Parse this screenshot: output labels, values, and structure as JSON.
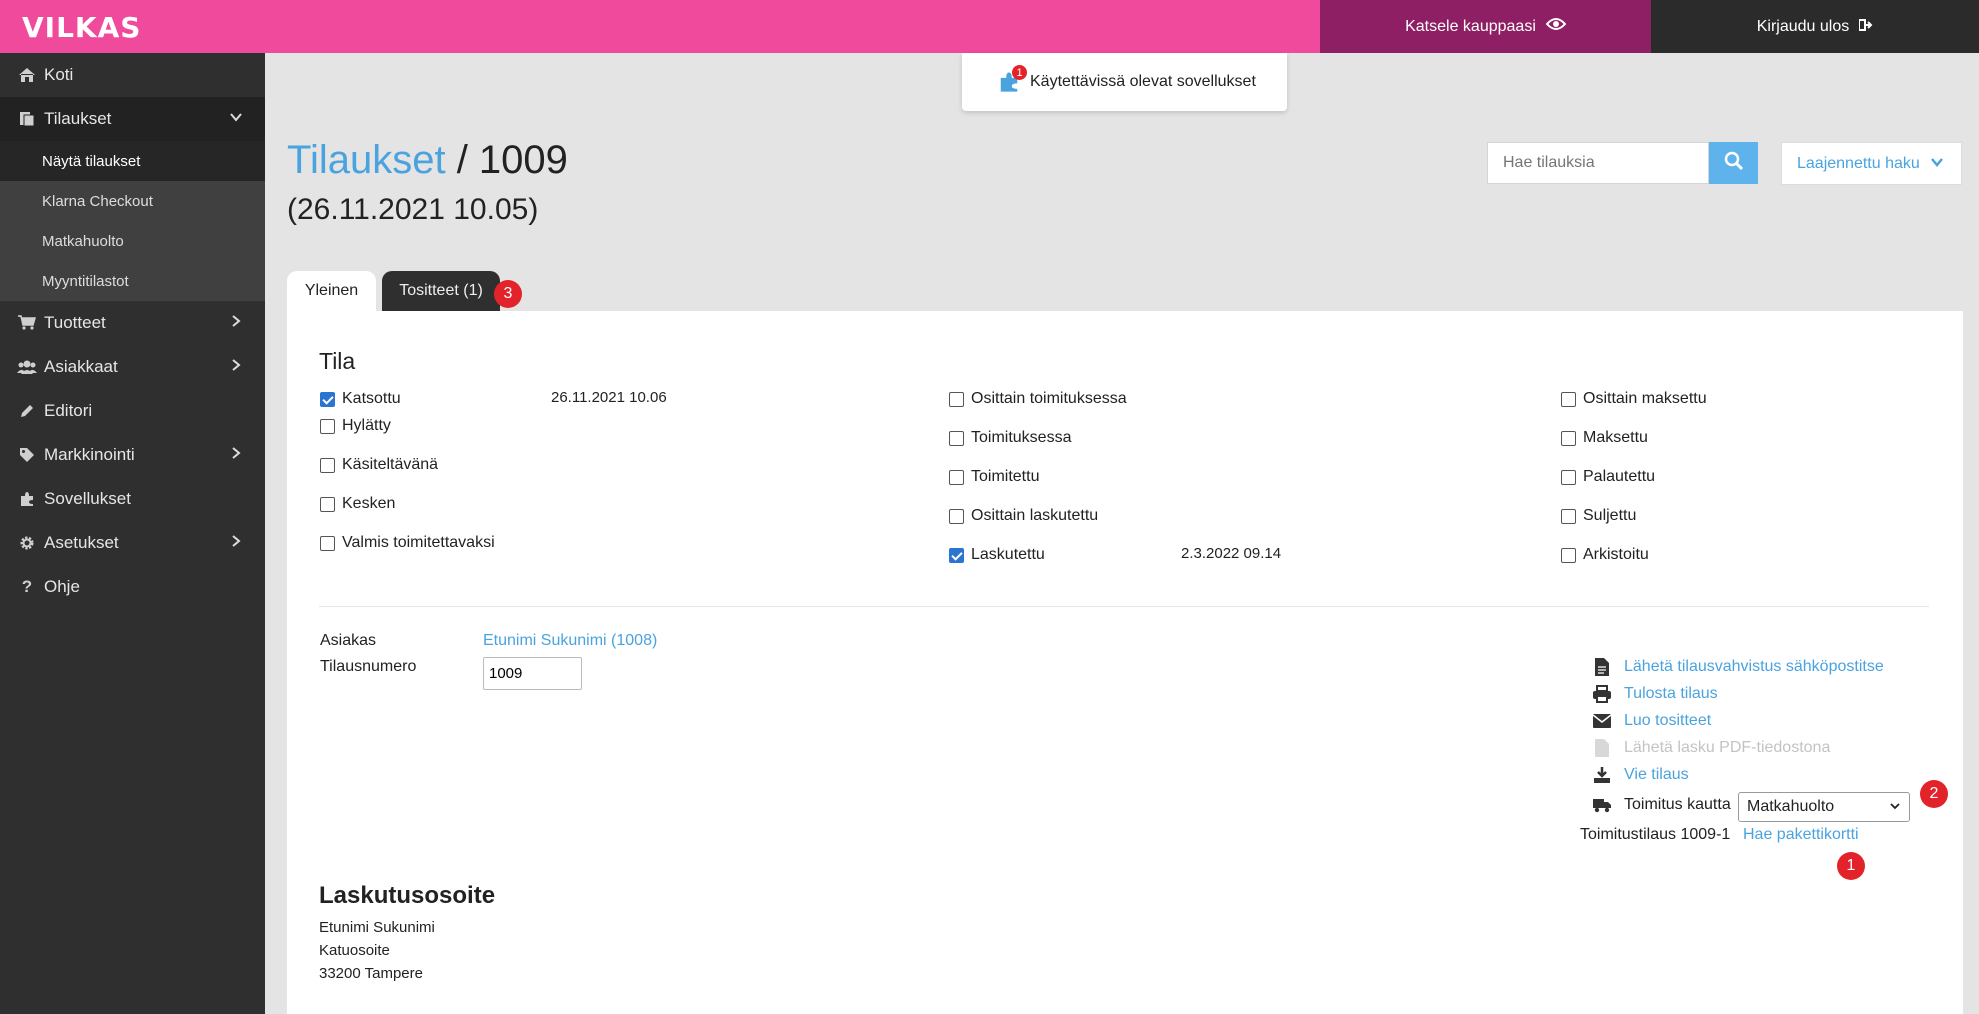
{
  "brand": {
    "logo": "VILKAS",
    "pink": "#ef4a9b",
    "accent": "#4aa3df"
  },
  "topbar": {
    "view_store": "Katsele kauppaasi",
    "logout": "Kirjaudu ulos"
  },
  "sidebar": {
    "items": [
      {
        "label": "Koti",
        "icon": "home-icon"
      },
      {
        "label": "Tilaukset",
        "icon": "orders-icon"
      },
      {
        "label": "Tuotteet",
        "icon": "cart-icon"
      },
      {
        "label": "Asiakkaat",
        "icon": "users-icon"
      },
      {
        "label": "Editori",
        "icon": "pencil-icon"
      },
      {
        "label": "Markkinointi",
        "icon": "tag-icon"
      },
      {
        "label": "Sovellukset",
        "icon": "puzzle-icon"
      },
      {
        "label": "Asetukset",
        "icon": "gear-icon"
      },
      {
        "label": "Ohje",
        "icon": "question-icon"
      }
    ],
    "sub_items": [
      "Näytä tilaukset",
      "Klarna Checkout",
      "Matkahuolto",
      "Myyntitilastot"
    ]
  },
  "apps_popup": {
    "label": "Käytettävissä olevat sovellukset",
    "badge": "1"
  },
  "header": {
    "crumb": "Tilaukset",
    "separator": " / ",
    "order_id": "1009",
    "datetime": "(26.11.2021 10.05)"
  },
  "search": {
    "placeholder": "Hae tilauksia",
    "advanced": "Laajennettu haku"
  },
  "tabs": [
    {
      "label": "Yleinen"
    },
    {
      "label": "Tositteet (1)"
    }
  ],
  "annotations": {
    "tabs_badge": "3",
    "shipping_badge": "2",
    "parcel_badge": "1"
  },
  "status": {
    "title": "Tila",
    "col1": [
      {
        "label": "Katsottu",
        "checked": true,
        "date": "26.11.2021 10.06"
      },
      {
        "label": "Hylätty",
        "checked": false
      },
      {
        "label": "Käsiteltävänä",
        "checked": false
      },
      {
        "label": "Kesken",
        "checked": false
      },
      {
        "label": "Valmis toimitettavaksi",
        "checked": false
      }
    ],
    "col2": [
      {
        "label": "Osittain toimituksessa",
        "checked": false
      },
      {
        "label": "Toimituksessa",
        "checked": false
      },
      {
        "label": "Toimitettu",
        "checked": false
      },
      {
        "label": "Osittain laskutettu",
        "checked": false
      },
      {
        "label": "Laskutettu",
        "checked": true,
        "date": "2.3.2022 09.14"
      }
    ],
    "col3": [
      {
        "label": "Osittain maksettu",
        "checked": false
      },
      {
        "label": "Maksettu",
        "checked": false
      },
      {
        "label": "Palautettu",
        "checked": false
      },
      {
        "label": "Suljettu",
        "checked": false
      },
      {
        "label": "Arkistoitu",
        "checked": false
      }
    ]
  },
  "order": {
    "customer_label": "Asiakas",
    "customer_value": "Etunimi Sukunimi (1008)",
    "number_label": "Tilausnumero",
    "number_value": "1009"
  },
  "actions": {
    "send_confirmation": "Lähetä tilausvahvistus sähköpostitse",
    "print": "Tulosta tilaus",
    "create_vouchers": "Luo tositteet",
    "send_pdf": "Lähetä lasku PDF-tiedostona",
    "export": "Vie tilaus",
    "shipping_label": "Toimitus kautta",
    "shipping_value": "Matkahuolto",
    "delivery_order": "Toimitustilaus 1009-1",
    "parcel_card": "Hae pakettikortti"
  },
  "billing": {
    "title": "Laskutusosoite",
    "name": "Etunimi Sukunimi",
    "street": "Katuosoite",
    "city": "33200 Tampere"
  }
}
